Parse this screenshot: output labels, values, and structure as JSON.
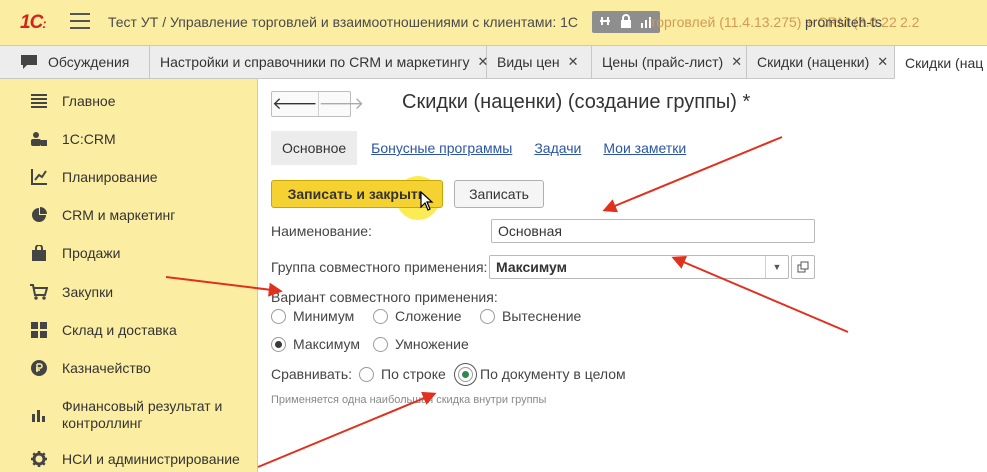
{
  "app": {
    "logo_text": "1С",
    "logo_sub": ":",
    "title": "Тест УТ / Управление торговлей и взаимоотношениями с клиентами: 1С",
    "title_faded": "торговлей (11.4.13.275) + CRM (3.0.22",
    "user": "promsiteh-ts",
    "user_tail": "2.2"
  },
  "tabs": [
    {
      "label": "Обсуждения",
      "closable": false
    },
    {
      "label": "Настройки и справочники по CRM и маркетингу",
      "closable": true
    },
    {
      "label": "Виды цен",
      "closable": true
    },
    {
      "label": "Цены (прайс-лист)",
      "closable": true
    },
    {
      "label": "Скидки (наценки)",
      "closable": true
    },
    {
      "label": "Скидки (нац",
      "closable": false
    }
  ],
  "close_glyph": "✕",
  "sidebar": {
    "items": [
      {
        "label": "Главное",
        "icon": "menu-icon"
      },
      {
        "label": "1С:CRM",
        "icon": "crm-people-icon"
      },
      {
        "label": "Планирование",
        "icon": "planning-chart-icon"
      },
      {
        "label": "CRM и маркетинг",
        "icon": "pie-chart-icon"
      },
      {
        "label": "Продажи",
        "icon": "bag-icon"
      },
      {
        "label": "Закупки",
        "icon": "cart-icon"
      },
      {
        "label": "Склад и доставка",
        "icon": "warehouse-grid-icon"
      },
      {
        "label": "Казначейство",
        "icon": "ruble-coin-icon"
      },
      {
        "label": "Финансовый результат и",
        "label2": "контроллинг",
        "icon": "bar-chart-icon"
      },
      {
        "label": "НСИ и администрирование",
        "icon": "gear-icon"
      }
    ]
  },
  "form": {
    "nav_back": "🡐",
    "nav_forward": "🡒",
    "title": "Скидки (наценки) (создание группы) *",
    "subtabs": [
      "Основное",
      "Бонусные программы",
      "Задачи",
      "Мои заметки"
    ],
    "save_close_label": "Записать и закрыть",
    "save_label": "Записать",
    "name_label": "Наименование:",
    "name_value": "Основная",
    "group_label": "Группа совместного применения:",
    "group_value": "Максимум",
    "variant_label": "Вариант совместного применения:",
    "variant_options": [
      "Минимум",
      "Сложение",
      "Вытеснение",
      "Максимум",
      "Умножение"
    ],
    "variant_selected": "Максимум",
    "compare_label": "Сравнивать:",
    "compare_options": [
      "По строке",
      "По документу в целом"
    ],
    "compare_selected": "По документу в целом",
    "hint": "Применяется одна наибольшая скидка внутри группы"
  },
  "colors": {
    "panel_yellow": "#fbeea2",
    "primary_button": "#f5d131",
    "annotation_arrow": "#e0301e",
    "link_blue": "#2a55a6"
  }
}
